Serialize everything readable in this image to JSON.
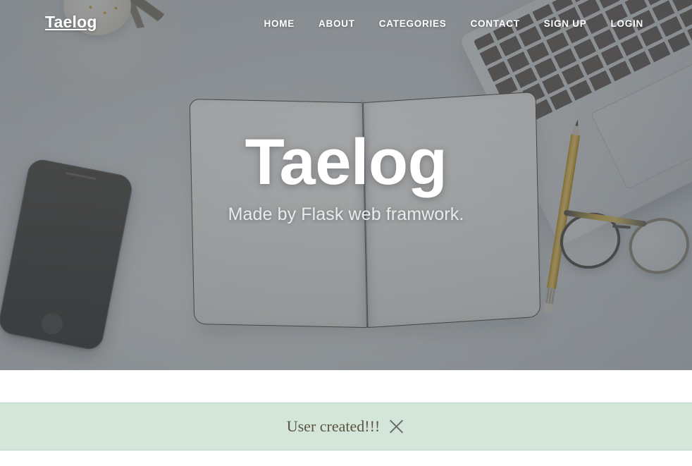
{
  "site": {
    "brand": "Taelog"
  },
  "nav": {
    "items": [
      {
        "label": "HOME",
        "name": "nav-link-home"
      },
      {
        "label": "ABOUT",
        "name": "nav-link-about"
      },
      {
        "label": "CATEGORIES",
        "name": "nav-link-categories"
      },
      {
        "label": "CONTACT",
        "name": "nav-link-contact"
      },
      {
        "label": "SIGN UP",
        "name": "nav-link-signup"
      },
      {
        "label": "LOGIN",
        "name": "nav-link-login"
      }
    ]
  },
  "hero": {
    "title": "Taelog",
    "subtitle": "Made by Flask web framwork.",
    "background_description": "desk flat-lay photo: open blank notebook, smartphone, yellow pencil, eyeglasses, laptop keyboard, white flowers",
    "overlay_color": "#42464b"
  },
  "alert": {
    "message": "User created!!!",
    "close_icon": "close-icon",
    "background_color": "#d4e6da",
    "text_color": "#5b5440",
    "border_color": "#c3dbcb"
  },
  "colors": {
    "page_background": "#ffffff",
    "nav_text": "#ffffff",
    "hero_title": "#ffffff",
    "hero_subtitle": "#e9eaec"
  }
}
